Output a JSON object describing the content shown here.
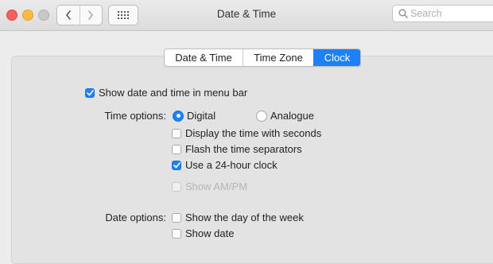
{
  "window": {
    "title": "Date & Time",
    "search": {
      "placeholder": "Search",
      "value": ""
    }
  },
  "tabs": [
    {
      "label": "Date & Time",
      "active": false
    },
    {
      "label": "Time Zone",
      "active": false
    },
    {
      "label": "Clock",
      "active": true
    }
  ],
  "clock": {
    "show_in_menu_bar": {
      "label": "Show date and time in menu bar",
      "checked": true
    },
    "time_options": {
      "label": "Time options:",
      "digital": {
        "label": "Digital",
        "selected": true
      },
      "analogue": {
        "label": "Analogue",
        "selected": false
      },
      "seconds": {
        "label": "Display the time with seconds",
        "checked": false
      },
      "flash_separators": {
        "label": "Flash the time separators",
        "checked": false
      },
      "hour24": {
        "label": "Use a 24-hour clock",
        "checked": true
      },
      "show_ampm": {
        "label": "Show AM/PM",
        "checked": false,
        "enabled": false
      }
    },
    "date_options": {
      "label": "Date options:",
      "day_of_week": {
        "label": "Show the day of the week",
        "checked": false
      },
      "show_date": {
        "label": "Show date",
        "checked": false
      }
    }
  },
  "colors": {
    "accent": "#1d82f9",
    "close": "#fc605c",
    "minimize": "#fdbc40",
    "zoom_inactive": "#c8c8c8"
  },
  "icons": [
    "close-icon",
    "minimize-icon",
    "zoom-icon",
    "back-icon",
    "forward-icon",
    "grid-icon",
    "search-icon",
    "checkmark-icon"
  ]
}
